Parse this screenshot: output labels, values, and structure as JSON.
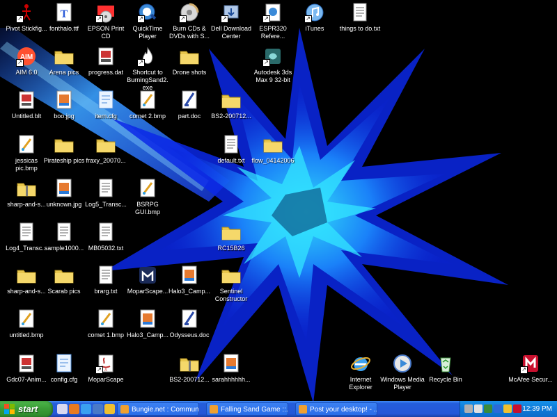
{
  "desktop": {
    "icons": [
      {
        "label": "Pivot Stickfig...",
        "type": "pivot-icon",
        "shortcut": true
      },
      {
        "label": "fonthalo.ttf",
        "type": "font-file-icon",
        "shortcut": false
      },
      {
        "label": "EPSON Print CD",
        "type": "epson-print-cd-icon",
        "shortcut": true
      },
      {
        "label": "QuickTime Player",
        "type": "quicktime-icon",
        "shortcut": true
      },
      {
        "label": "Burn CDs & DVDs with S...",
        "type": "cd-burn-icon",
        "shortcut": true
      },
      {
        "label": "Dell Download Center",
        "type": "dell-download-icon",
        "shortcut": true
      },
      {
        "label": "ESPR320 Refere...",
        "type": "espr-reference-icon",
        "shortcut": true
      },
      {
        "label": "iTunes",
        "type": "itunes-icon",
        "shortcut": true
      },
      {
        "label": "things to do.txt",
        "type": "text-file-icon",
        "shortcut": false
      },
      {
        "label": "AIM 6.0",
        "type": "aim-icon",
        "shortcut": true
      },
      {
        "label": "Arena pics",
        "type": "folder-icon",
        "shortcut": false
      },
      {
        "label": "progress.dat",
        "type": "dat-file-icon",
        "shortcut": false
      },
      {
        "label": "Shortcut to BurningSand2.exe",
        "type": "fire-icon",
        "shortcut": true
      },
      {
        "label": "Drone shots",
        "type": "folder-icon",
        "shortcut": false
      },
      {
        "label": "Autodesk 3ds Max 9 32-bit",
        "type": "3ds-max-icon",
        "shortcut": true
      },
      {
        "label": "Untitled.blt",
        "type": "blt-file-icon",
        "shortcut": false
      },
      {
        "label": "boo.jpg",
        "type": "jpg-file-icon",
        "shortcut": false
      },
      {
        "label": "item.cfg",
        "type": "cfg-file-icon",
        "shortcut": false
      },
      {
        "label": "comet 2.bmp",
        "type": "bmp-file-icon",
        "shortcut": false
      },
      {
        "label": "part.doc",
        "type": "doc-file-icon",
        "shortcut": false
      },
      {
        "label": "BS2-200712...",
        "type": "folder-icon",
        "shortcut": false
      },
      {
        "label": "jessicas pic.bmp",
        "type": "bmp-file-icon",
        "shortcut": false
      },
      {
        "label": "Pirateship pics",
        "type": "folder-icon",
        "shortcut": false
      },
      {
        "label": "fraxy_20070...",
        "type": "folder-icon",
        "shortcut": false
      },
      {
        "label": "default.txt",
        "type": "text-file-icon",
        "shortcut": false
      },
      {
        "label": "flow_04142006",
        "type": "folder-icon",
        "shortcut": false
      },
      {
        "label": "sharp-and-s...",
        "type": "zip-folder-icon",
        "shortcut": false
      },
      {
        "label": "unknown.jpg",
        "type": "jpg-file-icon",
        "shortcut": false
      },
      {
        "label": "Log5_Transc...",
        "type": "text-file-icon",
        "shortcut": false
      },
      {
        "label": "BSRPG GUI.bmp",
        "type": "bmp-file-icon",
        "shortcut": false
      },
      {
        "label": "Log4_Transc...",
        "type": "text-file-icon",
        "shortcut": false
      },
      {
        "label": "sample1000...",
        "type": "text-file-icon",
        "shortcut": false
      },
      {
        "label": "MB05032.txt",
        "type": "text-file-icon",
        "shortcut": false
      },
      {
        "label": "RC15B26",
        "type": "folder-icon",
        "shortcut": false
      },
      {
        "label": "sharp-and-s...",
        "type": "folder-icon",
        "shortcut": false
      },
      {
        "label": "Scarab pics",
        "type": "folder-icon",
        "shortcut": false
      },
      {
        "label": "brarg.txt",
        "type": "text-file-icon",
        "shortcut": false
      },
      {
        "label": "MoparScape...",
        "type": "mopar-icon",
        "shortcut": false
      },
      {
        "label": "Halo3_Camp...",
        "type": "jpg-file-icon",
        "shortcut": false
      },
      {
        "label": "Sentinel Constructor",
        "type": "folder-icon",
        "shortcut": false
      },
      {
        "label": "untitled.bmp",
        "type": "bmp-file-icon",
        "shortcut": false
      },
      {
        "label": "comet 1.bmp",
        "type": "bmp-file-icon",
        "shortcut": false
      },
      {
        "label": "Halo3_Camp...",
        "type": "jpg-file-icon",
        "shortcut": false
      },
      {
        "label": "Odysseus.doc",
        "type": "doc-file-icon",
        "shortcut": false
      },
      {
        "label": "Gdc07-Anim...",
        "type": "dat-file-icon",
        "shortcut": false
      },
      {
        "label": "config.cfg",
        "type": "cfg-file-icon",
        "shortcut": false
      },
      {
        "label": "MoparScape",
        "type": "java-jar-icon",
        "shortcut": true
      },
      {
        "label": "BS2-200712...",
        "type": "zip-folder-icon",
        "shortcut": false
      },
      {
        "label": "sarahhhhhh...",
        "type": "jpg-file-icon",
        "shortcut": false
      },
      {
        "label": "Internet Explorer",
        "type": "internet-explorer-icon",
        "shortcut": false
      },
      {
        "label": "Windows Media Player",
        "type": "windows-media-player-icon",
        "shortcut": false
      },
      {
        "label": "Recycle Bin",
        "type": "recycle-bin-icon",
        "shortcut": false
      },
      {
        "label": "McAfee Secur...",
        "type": "mcafee-icon",
        "shortcut": true
      }
    ]
  },
  "taskbar": {
    "start_label": "start",
    "quick_launch": [
      "show-desktop-icon",
      "firefox-icon",
      "internet-explorer-icon",
      "windows-media-player-icon",
      "outlook-icon"
    ],
    "tasks": [
      {
        "label": "Bungie.net : Commun...",
        "icon": "browser-window-icon"
      },
      {
        "label": "Falling Sand Game ::...",
        "icon": "browser-window-icon"
      },
      {
        "label": "Post your desktop! - ...",
        "icon": "browser-window-icon"
      }
    ],
    "tray_icons": [
      "network-icon",
      "volume-icon",
      "antivirus-icon",
      "update-icon",
      "messenger-icon",
      "mcafee-tray-icon"
    ],
    "clock": "12:39 PM"
  },
  "colors": {
    "taskbar_blue": "#245edb",
    "start_green": "#3a9c36",
    "tray_blue": "#0f7bd8",
    "wallpaper_blue": "#1a3cff",
    "wallpaper_cyan": "#2ad3ff"
  }
}
